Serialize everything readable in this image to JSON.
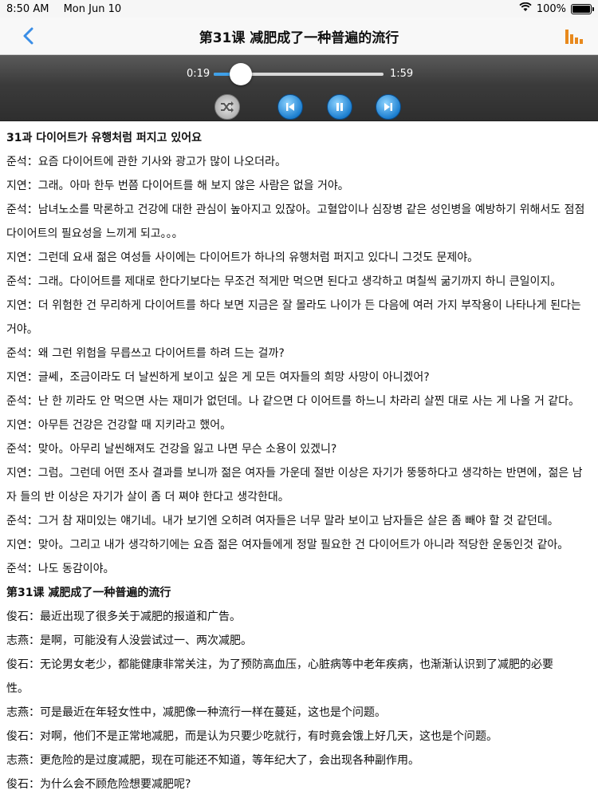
{
  "status": {
    "time": "8:50 AM",
    "date": "Mon Jun 10",
    "battery": "100%",
    "battery_level": 1.0
  },
  "nav": {
    "title": "第31课 减肥成了一种普遍的流行",
    "back_icon": "chevron-left-icon",
    "chart_icon": "bar-chart-icon",
    "accent": "#e8891d",
    "back_color": "#3a8ee6"
  },
  "player": {
    "elapsed": "0:19",
    "total": "1:59",
    "progress": 0.16,
    "shuffle_icon": "shuffle-icon",
    "prev_icon": "skip-previous-icon",
    "pause_icon": "pause-icon",
    "next_icon": "skip-next-icon"
  },
  "content": {
    "lines": [
      "31과 다이어트가 유행처럼 퍼지고 있어요",
      "준석：요즘 다이어트에 관한 기사와 광고가 많이 나오더라。",
      "지연：그래。아마 한두 번쯤 다이어트를 해 보지 않은 사람은 없을 거야。",
      "준석：남녀노소를 막론하고 건강에 대한 관심이 높아지고 있잖아。고혈압이나 심장병 같은 성인병을 예방하기 위해서도 점점",
      "다이어트의 필요성을 느끼게 되고。。。",
      "지연：그런데 요새 젊은 여성들 사이에는 다이어트가 하나의 유행처럼 퍼지고 있다니 그것도 문제야。",
      "준석：그래。다이어트를 제대로 한다기보다는 무조건 적게만 먹으면 된다고 생각하고 며칠씩 굶기까지 하니 큰일이지。",
      "지연：더 위험한 건 무리하게 다이어트를 하다 보면 지금은 잘 몰라도 나이가 든 다음에 여러 가지 부작용이 나타나게 된다는",
      "거야。",
      "준석：왜 그런 위험을 무릅쓰고 다이어트를 하려 드는 걸까?",
      "지연：글쎄，조금이라도 더 날씬하게 보이고 싶은 게 모든 여자들의 희망 사망이 아니겠어?",
      "준석：난 한 끼라도 안 먹으면 사는 재미가 없던데。나 같으면 다 이어트를 하느니 차라리 살찐 대로 사는 게 나올 거 같다。",
      "지연：아무튼 건강은 건강할 때 지키라고 했어。",
      "준석：맞아。아무리 날씬해져도 건강을 잃고 나면 무슨 소용이 있겠니?",
      "지연：그럼。그런데 어떤 조사 결과를 보니까 젊은 여자들 가운데 절반 이상은 자기가 뚱뚱하다고 생각하는 반면에，젊은 남",
      "자 들의 반 이상은 자기가 살이 좀 더 쪄야 한다고 생각한대。",
      "준석：그거 참 재미있는 얘기네。내가 보기엔 오히려 여자들은 너무 말라 보이고 남자들은 살은 좀 빼야 할 것 같던데。",
      "지연：맞아。그리고 내가 생각하기에는 요즘 젊은 여자들에게 정말 필요한 건 다이어트가 아니라 적당한 운동인것 같아。",
      "준석：나도 동감이야。",
      "第31课 减肥成了一种普遍的流行",
      "俊石：最近出现了很多关于减肥的报道和广告。",
      "志燕：是啊，可能没有人没尝试过一、两次减肥。",
      "俊石：无论男女老少，都能健康非常关注，为了预防高血压，心脏病等中老年疾病，也渐渐认识到了减肥的必要",
      "性。",
      "志燕：可是最近在年轻女性中，减肥像一种流行一样在蔓延，这也是个问题。",
      "俊石：对啊，他们不是正常地减肥，而是认为只要少吃就行，有时竟会饿上好几天，这也是个问题。",
      "志燕：更危险的是过度减肥，现在可能还不知道，等年纪大了，会出现各种副作用。",
      "俊石：为什么会不顾危险想要减肥呢?"
    ],
    "bold_lines": [
      0,
      19
    ]
  }
}
